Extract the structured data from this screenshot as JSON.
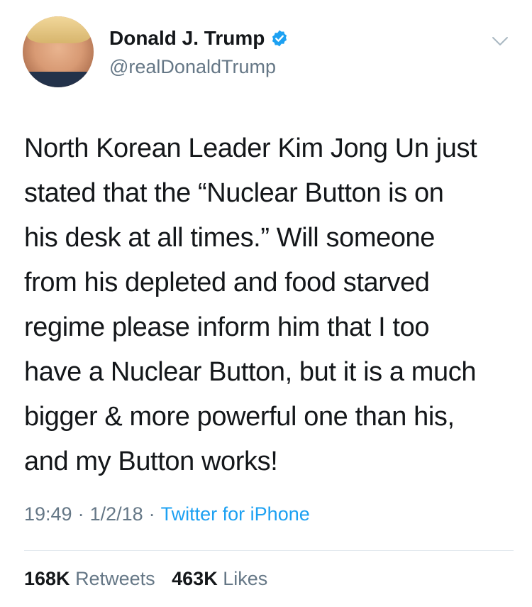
{
  "author": {
    "display_name": "Donald J. Trump",
    "handle": "@realDonaldTrump",
    "verified": true,
    "avatar": "profile-photo"
  },
  "tweet": {
    "text": "North Korean Leader Kim Jong Un just\nstated that the “Nuclear Button is on\nhis desk at all times.” Will someone\nfrom his depleted and food starved\nregime please inform him that I too\nhave a Nuclear Button, but it is a much\nbigger & more powerful one than his,\nand my Button works!",
    "time": "19:49",
    "date": "1/2/18",
    "source": "Twitter for iPhone",
    "separator": "·"
  },
  "stats": {
    "retweets_count": "168K",
    "retweets_label": "Retweets",
    "likes_count": "463K",
    "likes_label": "Likes"
  },
  "colors": {
    "text": "#14171a",
    "secondary": "#657786",
    "accent": "#1da1f2",
    "divider": "#e1e8ed"
  },
  "icons": {
    "verified": "verified-badge-icon",
    "menu": "chevron-down-icon"
  }
}
